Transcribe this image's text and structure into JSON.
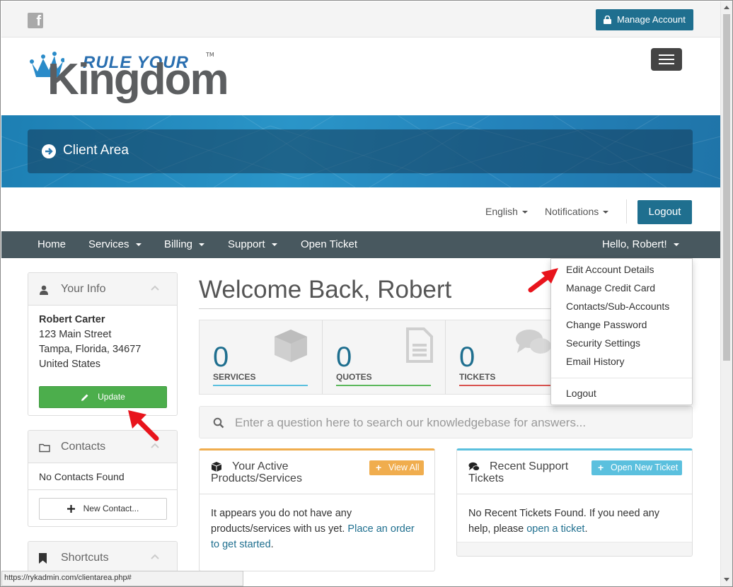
{
  "topbar": {
    "facebook_icon": "facebook-icon",
    "manage_account_label": "Manage Account"
  },
  "logo": {
    "alt": "Rule Your Kingdom"
  },
  "banner": {
    "title": "Client Area"
  },
  "utility": {
    "language": "English",
    "notifications": "Notifications",
    "logout": "Logout"
  },
  "nav": {
    "items": [
      {
        "label": "Home",
        "dropdown": false
      },
      {
        "label": "Services",
        "dropdown": true
      },
      {
        "label": "Billing",
        "dropdown": true
      },
      {
        "label": "Support",
        "dropdown": true
      },
      {
        "label": "Open Ticket",
        "dropdown": false
      }
    ],
    "user_menu": "Hello, Robert!"
  },
  "sidebar": {
    "info": {
      "title": "Your Info",
      "name": "Robert Carter",
      "address1": "123 Main Street",
      "address2": "Tampa, Florida, 34677",
      "country": "United States",
      "update_label": "Update"
    },
    "contacts": {
      "title": "Contacts",
      "empty_text": "No Contacts Found",
      "new_contact_label": "New Contact..."
    },
    "shortcuts": {
      "title": "Shortcuts"
    }
  },
  "main": {
    "welcome": "Welcome Back, Robert",
    "tiles": [
      {
        "count": "0",
        "label": "SERVICES",
        "color": "#5bc0de"
      },
      {
        "count": "0",
        "label": "QUOTES",
        "color": "#5cb85c"
      },
      {
        "count": "0",
        "label": "TICKETS",
        "color": "#d9534f"
      }
    ],
    "search_placeholder": "Enter a question here to search our knowledgebase for answers...",
    "products_card": {
      "title_line1": "Your Active",
      "title_line2": "Products/Services",
      "button_label": "View All",
      "body_text": "It appears you do not have any products/services with us yet.",
      "link_text_1": "Place an order",
      "link_text_2": "to get started",
      "body_end": ".",
      "accent": "#f0ad4e"
    },
    "tickets_card": {
      "title_line1": "Recent Support",
      "title_line2": "Tickets",
      "button_label": "Open New Ticket",
      "body_text_1": "No Recent Tickets Found. If you need any",
      "body_text_2": "help, please",
      "link_text": "open a ticket",
      "body_end": ".",
      "accent": "#5bc0de"
    }
  },
  "user_dropdown": {
    "items": [
      "Edit Account Details",
      "Manage Credit Card",
      "Contacts/Sub-Accounts",
      "Change Password",
      "Security Settings",
      "Email History"
    ],
    "logout": "Logout"
  },
  "statusbar": {
    "url": "https://rykadmin.com/clientarea.php#"
  },
  "colors": {
    "primary": "#1f6f8f",
    "nav_bg": "#48585f",
    "success": "#4cae4c",
    "annotation_arrow": "#e8141c"
  }
}
